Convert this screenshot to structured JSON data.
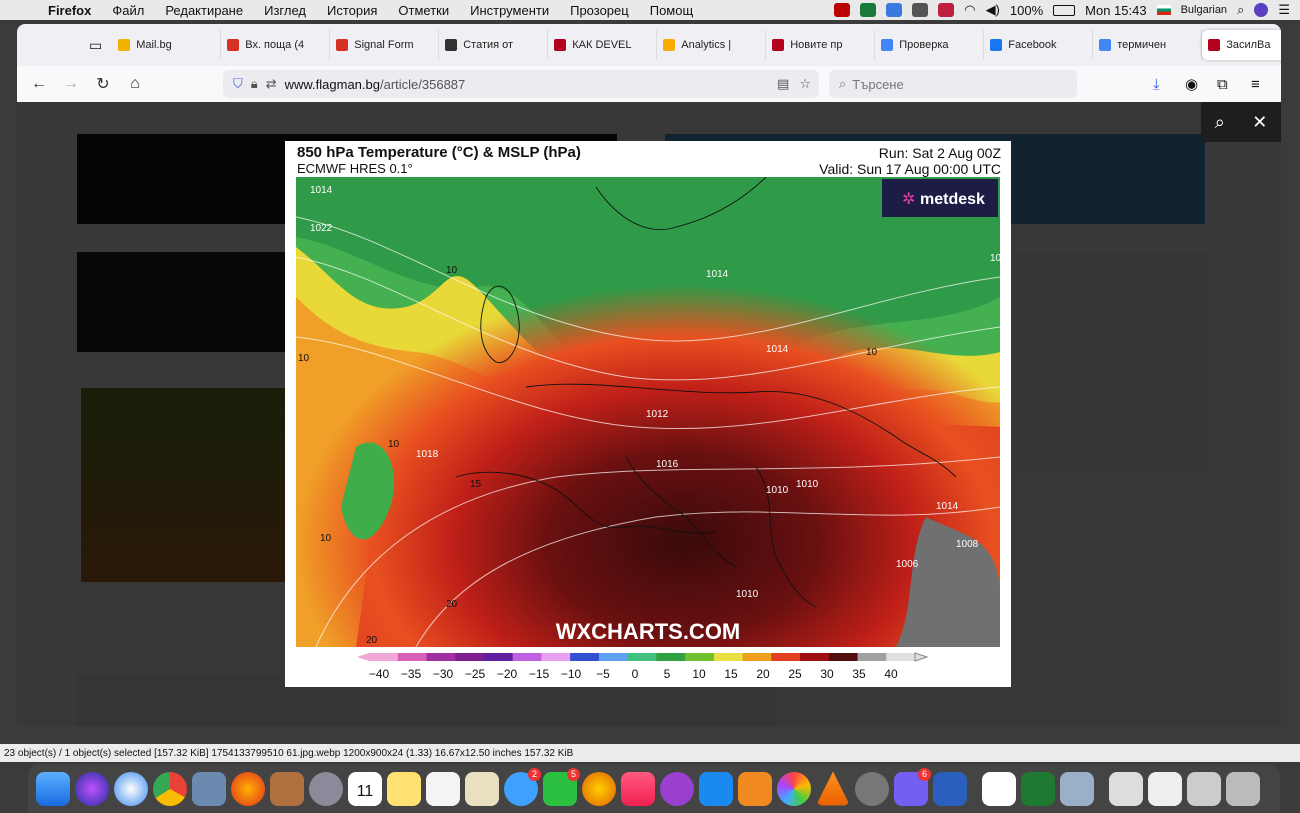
{
  "menubar": {
    "app": "Firefox",
    "items": [
      "Файл",
      "Редактиране",
      "Изглед",
      "История",
      "Отметки",
      "Инструменти",
      "Прозорец",
      "Помощ"
    ],
    "battery": "100%",
    "clock": "Mon 15:43",
    "language": "Bulgarian"
  },
  "tabs": [
    {
      "label": "Mail.bg",
      "color": "#f2b203"
    },
    {
      "label": "Вх. поща (4",
      "color": "#d93025"
    },
    {
      "label": "Signal Form",
      "color": "#d93025"
    },
    {
      "label": "Статия от",
      "color": "#333333"
    },
    {
      "label": "КАК DEVEL",
      "color": "#b3001b"
    },
    {
      "label": "Analytics | ",
      "color": "#f9ab00"
    },
    {
      "label": "Новите пр",
      "color": "#b3001b"
    },
    {
      "label": "Проверка",
      "color": "#4285f4"
    },
    {
      "label": "Facebook",
      "color": "#1877f2"
    },
    {
      "label": "термичен",
      "color": "#4285f4"
    }
  ],
  "active_tab": {
    "label": "ЗасилВа",
    "color": "#b3001b"
  },
  "urlbar": {
    "domain": "www.flagman.bg",
    "path": "/article/356887"
  },
  "search": {
    "placeholder": "Търсене"
  },
  "chart": {
    "title": "850 hPa Temperature (°C) & MSLP (hPa)",
    "model": "ECMWF HRES 0.1°",
    "run": "Run: Sat 2 Aug 00Z",
    "valid": "Valid: Sun 17 Aug 00:00 UTC",
    "brand": "metdesk",
    "watermark": "WXCHARTS.COM"
  },
  "chart_data": {
    "type": "heatmap",
    "title": "850 hPa Temperature (°C) & MSLP (hPa)",
    "colorbar_ticks": [
      -40,
      -35,
      -30,
      -25,
      -20,
      -15,
      -10,
      -5,
      0,
      5,
      10,
      15,
      20,
      25,
      30,
      35,
      40
    ],
    "colorbar_colors": [
      "#f0a8d8",
      "#d860b8",
      "#a030a0",
      "#802090",
      "#6020a0",
      "#c060e0",
      "#e8a0f0",
      "#3050d0",
      "#60a0f0",
      "#40c080",
      "#30a040",
      "#70c030",
      "#e8e040",
      "#f0a020",
      "#e04020",
      "#a01010",
      "#501010",
      "#a0a0a0",
      "#e0e0e0"
    ],
    "mslp_labels": [
      "1014",
      "1022",
      "1014",
      "1010",
      "1012",
      "1014",
      "1010",
      "1006",
      "1018",
      "1016",
      "1008",
      "1010",
      "1014",
      "1010"
    ],
    "temp_labels": [
      "10",
      "10",
      "10",
      "10",
      "10",
      "15",
      "20",
      "20"
    ]
  },
  "statusbar": "23 object(s) / 1 object(s) selected [157.32 KiB]   1754133799510 61.jpg.webp   1200x900x24 (1.33)   16.67x12.50 inches   157.32 KiB",
  "dock_badges": {
    "messages": "2",
    "facetime": "5",
    "viber": "6"
  },
  "dock_calendar_day": "11"
}
